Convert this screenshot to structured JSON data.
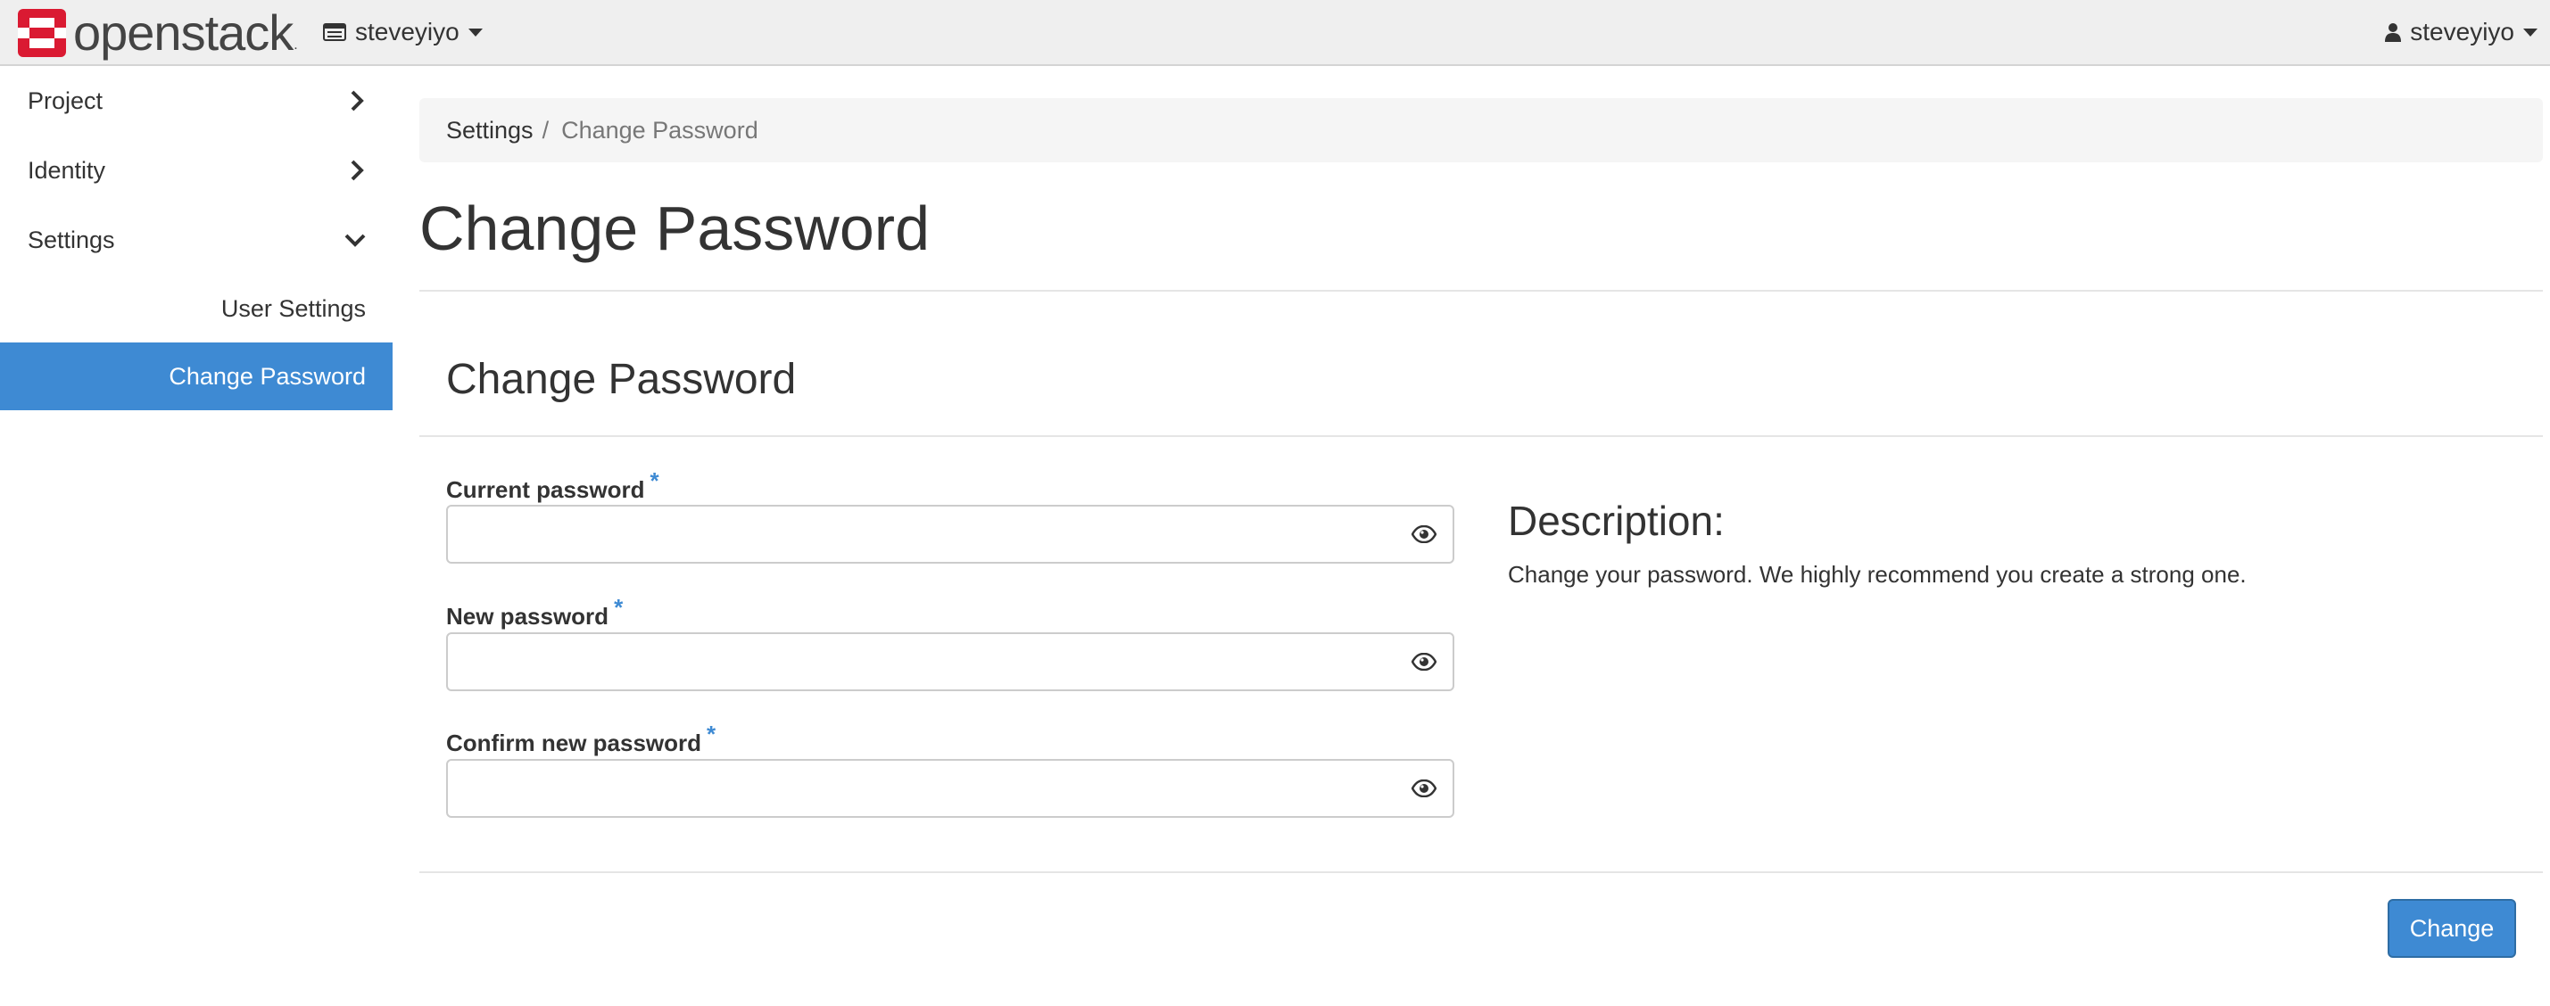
{
  "brand": {
    "name": "openstack",
    "trademark": ".",
    "logo_icon": "openstack-logo-icon",
    "accent": "#da1a32"
  },
  "header": {
    "project_selector": {
      "label": "steveyiyo",
      "icon": "project-icon"
    },
    "user_menu": {
      "label": "steveyiyo",
      "icon": "user-icon"
    }
  },
  "sidebar": {
    "items": [
      {
        "label": "Project",
        "icon": "chevron-right-icon",
        "expanded": false
      },
      {
        "label": "Identity",
        "icon": "chevron-right-icon",
        "expanded": false
      },
      {
        "label": "Settings",
        "icon": "chevron-down-icon",
        "expanded": true
      }
    ],
    "subitems": [
      {
        "label": "User Settings",
        "active": false
      },
      {
        "label": "Change Password",
        "active": true
      }
    ],
    "active_color": "#3e8ad3"
  },
  "breadcrumb": {
    "parent": "Settings",
    "separator": "/",
    "current": "Change Password"
  },
  "page": {
    "title": "Change Password"
  },
  "form": {
    "title": "Change Password",
    "required_marker": "*",
    "fields": [
      {
        "label": "Current password",
        "value": "",
        "placeholder": "",
        "icon": "eye-icon"
      },
      {
        "label": "New password",
        "value": "",
        "placeholder": "",
        "icon": "eye-icon"
      },
      {
        "label": "Confirm new password",
        "value": "",
        "placeholder": "",
        "icon": "eye-icon"
      }
    ],
    "submit_label": "Change"
  },
  "description": {
    "title": "Description:",
    "text": "Change your password. We highly recommend you create a strong one."
  }
}
